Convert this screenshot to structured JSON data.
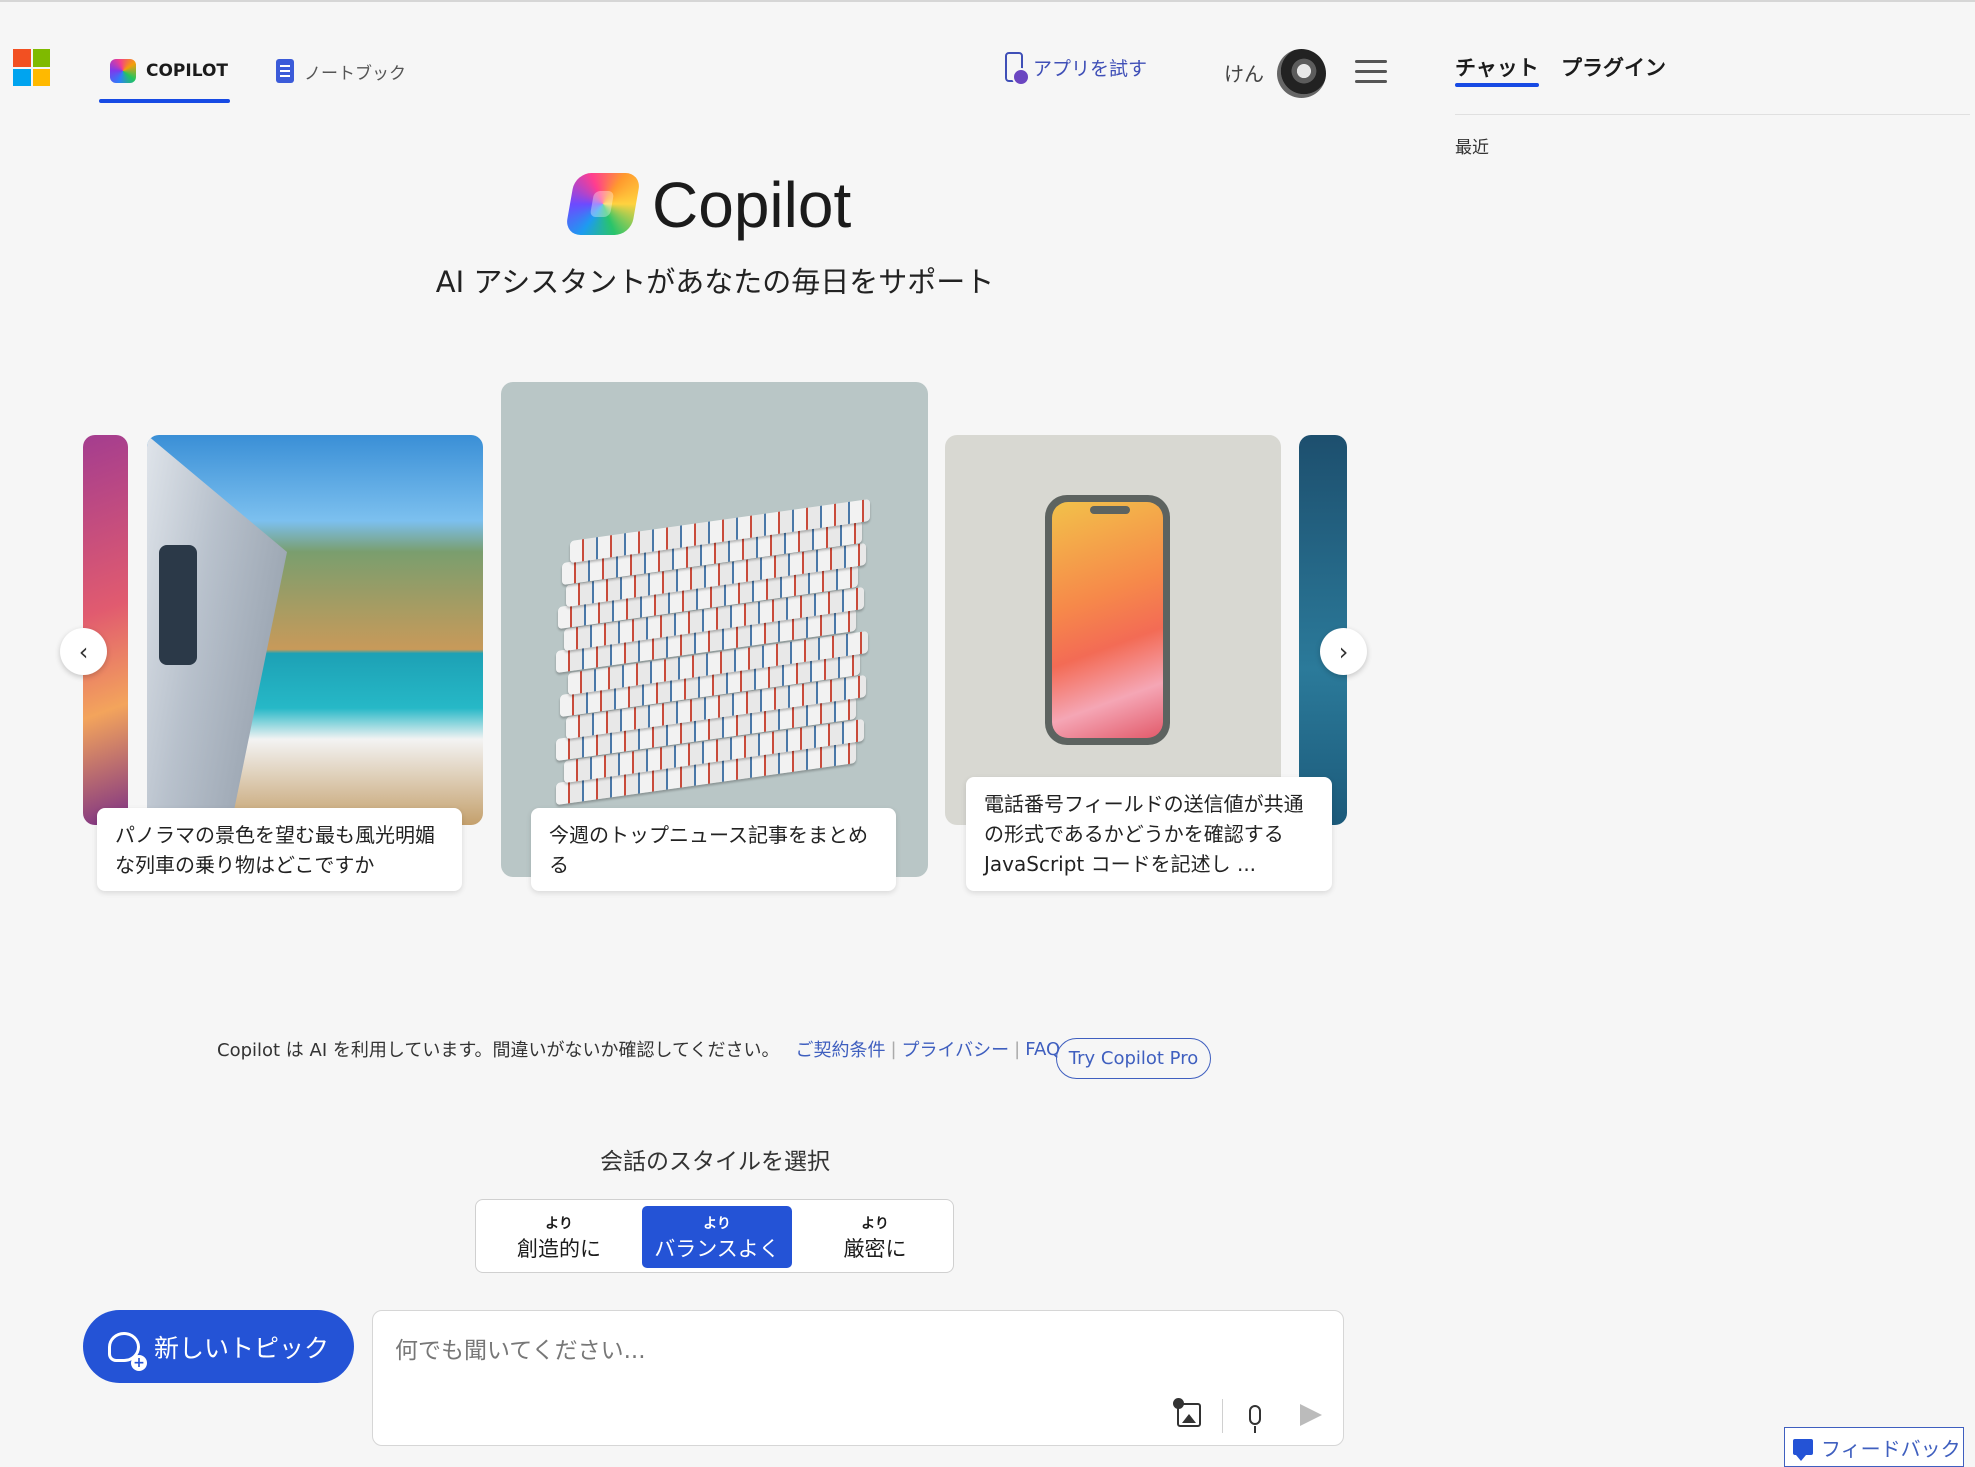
{
  "header": {
    "tabs": [
      {
        "label": "COPILOT",
        "active": true
      },
      {
        "label": "ノートブック",
        "active": false
      }
    ],
    "try_app_label": "アプリを試す",
    "username": "けん"
  },
  "side_panel": {
    "tabs": [
      {
        "label": "チャット",
        "active": true
      },
      {
        "label": "プラグイン",
        "active": false
      }
    ],
    "recent_label": "最近"
  },
  "hero": {
    "title": "Copilot",
    "subtitle": "AI アシスタントがあなたの毎日をサポート"
  },
  "carousel": {
    "cards": [
      {
        "caption": "パノラマの景色を望む最も風光明媚な列車の乗り物はどこですか",
        "image": "coastal-train"
      },
      {
        "caption": "今週のトップニュース記事をまとめる",
        "image": "newspaper-stack"
      },
      {
        "caption": "電話番号フィールドの送信値が共通の形式であるかどうかを確認する JavaScript コードを記述し ...",
        "image": "smartphone"
      }
    ],
    "prev_icon": "chevron-left-icon",
    "next_icon": "chevron-right-icon"
  },
  "disclaimer": {
    "text": "Copilot は AI を利用しています。間違いがないか確認してください。",
    "links": [
      "ご契約条件",
      "プライバシー",
      "FAQ"
    ],
    "pro_button": "Try Copilot Pro"
  },
  "style_selector": {
    "title": "会話のスタイルを選択",
    "options": [
      {
        "small": "より",
        "big": "創造的に",
        "selected": false
      },
      {
        "small": "より",
        "big": "バランスよく",
        "selected": true
      },
      {
        "small": "より",
        "big": "厳密に",
        "selected": false
      }
    ]
  },
  "composer": {
    "new_topic_label": "新しいトピック",
    "placeholder": "何でも聞いてください..."
  },
  "feedback_label": "フィードバック",
  "colors": {
    "accent": "#2453d6",
    "link": "#3f5fbf",
    "background": "#f6f6f6"
  }
}
